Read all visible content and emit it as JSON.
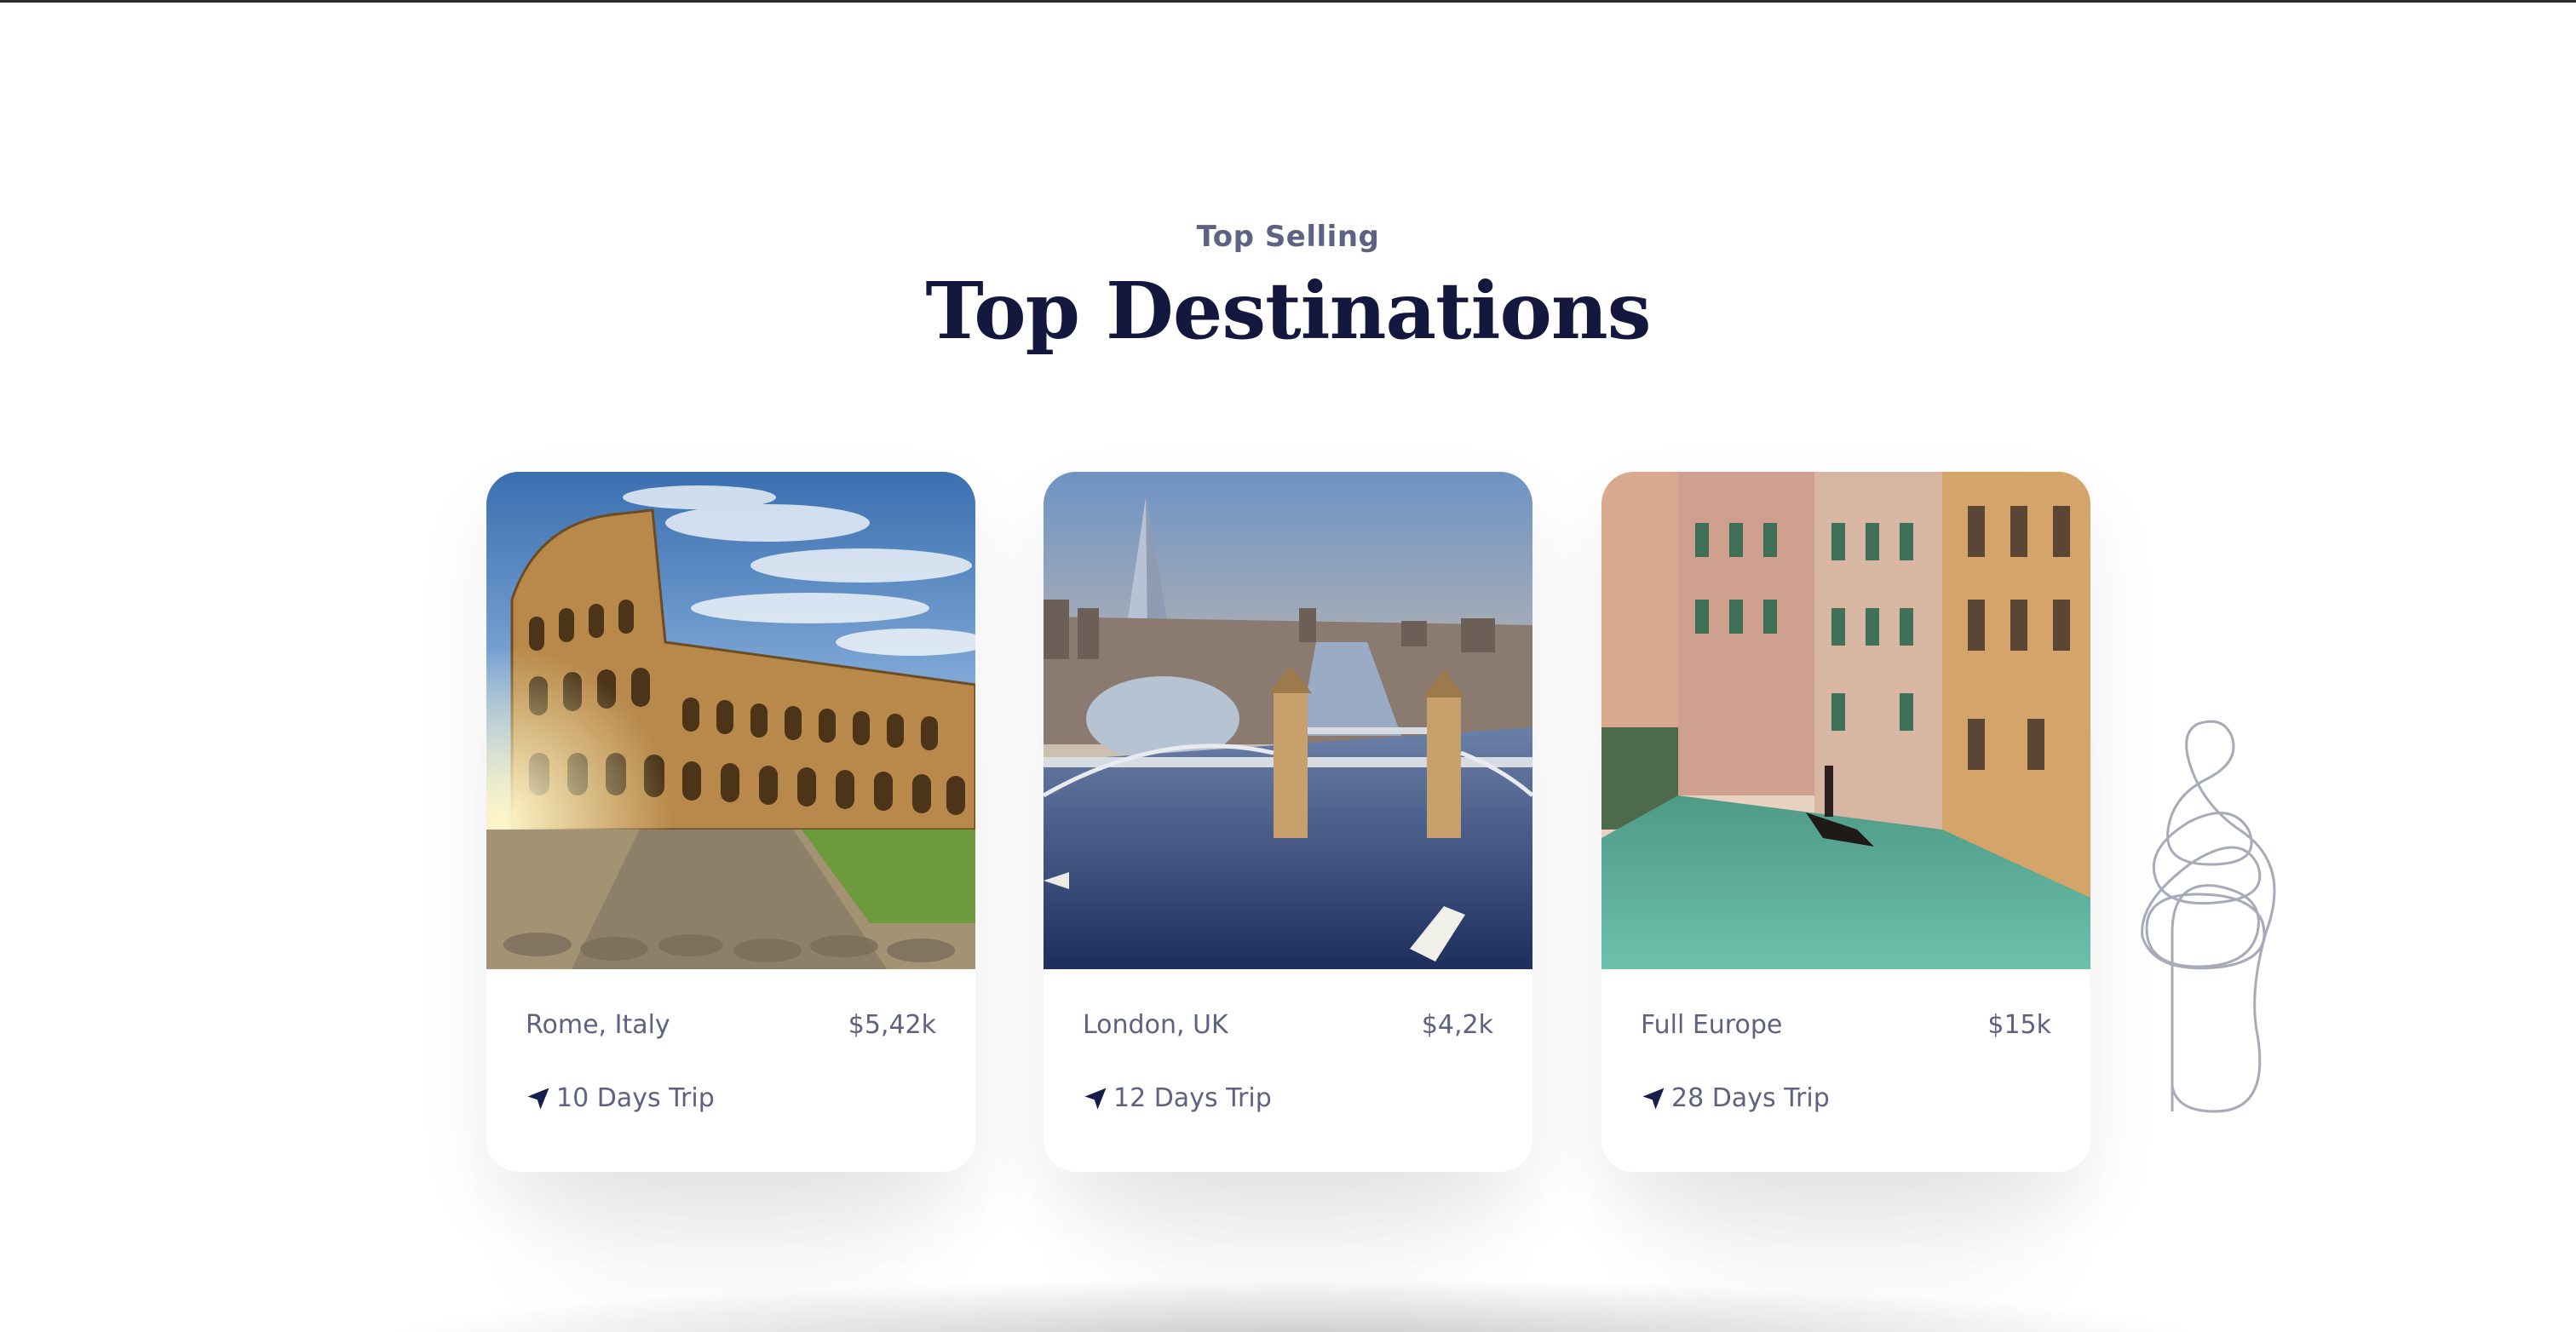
{
  "section": {
    "eyebrow": "Top Selling",
    "title": "Top Destinations"
  },
  "destinations": [
    {
      "name": "Rome, Italy",
      "price": "$5,42k",
      "trip": "10 Days Trip",
      "icon": "navigation-arrow-icon"
    },
    {
      "name": "London, UK",
      "price": "$4,2k",
      "trip": "12 Days Trip",
      "icon": "navigation-arrow-icon"
    },
    {
      "name": "Full Europe",
      "price": "$15k",
      "trip": "28 Days Trip",
      "icon": "navigation-arrow-icon"
    }
  ],
  "colors": {
    "heading": "#14183e",
    "text": "#5e6282",
    "card_bg": "#ffffff"
  }
}
